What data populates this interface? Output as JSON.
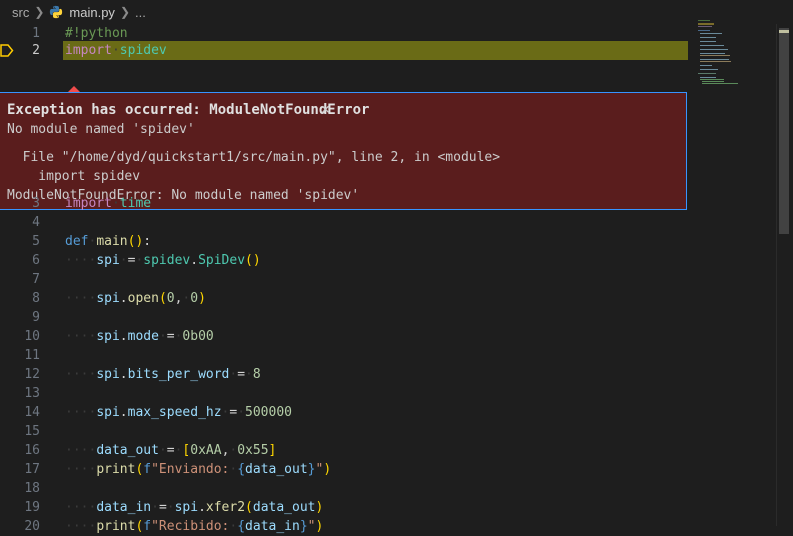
{
  "breadcrumb": {
    "folder": "src",
    "file": "main.py",
    "more": "..."
  },
  "editor": {
    "lines": [
      {
        "num": "1",
        "text": "#!python"
      },
      {
        "num": "2",
        "text": "import spidev",
        "active": true
      },
      {
        "num": "3",
        "text": "import time"
      },
      {
        "num": "4",
        "text": ""
      },
      {
        "num": "5",
        "text": "def main():"
      },
      {
        "num": "6",
        "text": "    spi = spidev.SpiDev()"
      },
      {
        "num": "7",
        "text": ""
      },
      {
        "num": "8",
        "text": "    spi.open(0, 0)"
      },
      {
        "num": "9",
        "text": ""
      },
      {
        "num": "10",
        "text": "    spi.mode = 0b00"
      },
      {
        "num": "11",
        "text": ""
      },
      {
        "num": "12",
        "text": "    spi.bits_per_word = 8"
      },
      {
        "num": "13",
        "text": ""
      },
      {
        "num": "14",
        "text": "    spi.max_speed_hz = 500000"
      },
      {
        "num": "15",
        "text": ""
      },
      {
        "num": "16",
        "text": "    data_out = [0xAA, 0x55]"
      },
      {
        "num": "17",
        "text": "    print(f\"Enviando: {data_out}\")"
      },
      {
        "num": "18",
        "text": ""
      },
      {
        "num": "19",
        "text": "    data_in = spi.xfer2(data_out)"
      },
      {
        "num": "20",
        "text": "    print(f\"Recibido: {data_in}\")"
      }
    ]
  },
  "exception": {
    "title": "Exception has occurred: ModuleNotFoundError",
    "close_icon": "×",
    "message": "No module named 'spidev'",
    "trace_file": "  File \"/home/dyd/quickstart1/src/main.py\", line 2, in <module>",
    "trace_code": "    import spidev",
    "trace_error": "ModuleNotFoundError: No module named 'spidev'"
  },
  "colors": {
    "background": "#1e1e1e",
    "exception_bg": "#5a1d1d",
    "exception_border": "#3794ff",
    "current_line": "#6a6b16"
  }
}
